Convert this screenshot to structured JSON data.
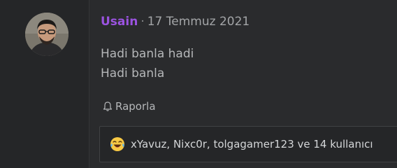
{
  "post": {
    "author": "Usain",
    "separator": "·",
    "date": "17 Temmuz 2021",
    "lines": [
      "Hadi banla hadi",
      "Hadi banla"
    ],
    "report_label": "Raporla",
    "reactions_text": "xYavuz, Nixc0r, tolgagamer123 ve 14 kullanıcı",
    "reaction_icon": "laughing-crying-emoji-icon",
    "author_color": "#9b53e0"
  }
}
